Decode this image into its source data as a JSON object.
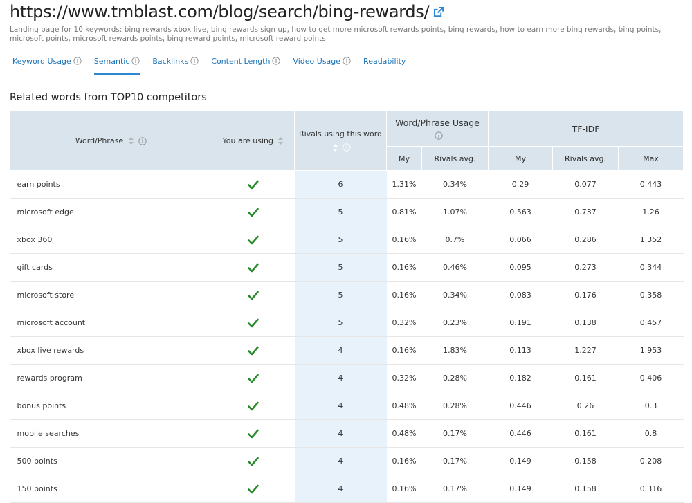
{
  "page": {
    "url": "https://www.tmblast.com/blog/search/bing-rewards/",
    "description": "Landing page for 10 keywords: bing rewards xbox live, bing rewards sign up, how to get more microsoft rewards points, bing rewards, how to earn more bing rewards, bing points, microsoft points, microsoft rewards points, bing reward points, microsoft reward points"
  },
  "tabs": [
    {
      "label": "Keyword Usage",
      "info": true
    },
    {
      "label": "Semantic",
      "info": true,
      "active": true
    },
    {
      "label": "Backlinks",
      "info": true
    },
    {
      "label": "Content Length",
      "info": true
    },
    {
      "label": "Video Usage",
      "info": true
    },
    {
      "label": "Readability",
      "info": false
    }
  ],
  "section_title": "Related words from TOP10 competitors",
  "table": {
    "headers": {
      "word": "Word/Phrase",
      "using": "You are using",
      "rivals": "Rivals using this word",
      "usage_group": "Word/Phrase Usage",
      "tfidf_group": "TF-IDF",
      "my": "My",
      "rivals_avg": "Rivals avg.",
      "max": "Max"
    },
    "rows": [
      {
        "word": "earn points",
        "rivals": "6",
        "usage_my": "1.31%",
        "usage_avg": "0.34%",
        "tf_my": "0.29",
        "tf_avg": "0.077",
        "tf_max": "0.443"
      },
      {
        "word": "microsoft edge",
        "rivals": "5",
        "usage_my": "0.81%",
        "usage_avg": "1.07%",
        "tf_my": "0.563",
        "tf_avg": "0.737",
        "tf_max": "1.26"
      },
      {
        "word": "xbox 360",
        "rivals": "5",
        "usage_my": "0.16%",
        "usage_avg": "0.7%",
        "tf_my": "0.066",
        "tf_avg": "0.286",
        "tf_max": "1.352"
      },
      {
        "word": "gift cards",
        "rivals": "5",
        "usage_my": "0.16%",
        "usage_avg": "0.46%",
        "tf_my": "0.095",
        "tf_avg": "0.273",
        "tf_max": "0.344"
      },
      {
        "word": "microsoft store",
        "rivals": "5",
        "usage_my": "0.16%",
        "usage_avg": "0.34%",
        "tf_my": "0.083",
        "tf_avg": "0.176",
        "tf_max": "0.358"
      },
      {
        "word": "microsoft account",
        "rivals": "5",
        "usage_my": "0.32%",
        "usage_avg": "0.23%",
        "tf_my": "0.191",
        "tf_avg": "0.138",
        "tf_max": "0.457"
      },
      {
        "word": "xbox live rewards",
        "rivals": "4",
        "usage_my": "0.16%",
        "usage_avg": "1.83%",
        "tf_my": "0.113",
        "tf_avg": "1.227",
        "tf_max": "1.953"
      },
      {
        "word": "rewards program",
        "rivals": "4",
        "usage_my": "0.32%",
        "usage_avg": "0.28%",
        "tf_my": "0.182",
        "tf_avg": "0.161",
        "tf_max": "0.406"
      },
      {
        "word": "bonus points",
        "rivals": "4",
        "usage_my": "0.48%",
        "usage_avg": "0.28%",
        "tf_my": "0.446",
        "tf_avg": "0.26",
        "tf_max": "0.3"
      },
      {
        "word": "mobile searches",
        "rivals": "4",
        "usage_my": "0.48%",
        "usage_avg": "0.17%",
        "tf_my": "0.446",
        "tf_avg": "0.161",
        "tf_max": "0.8"
      },
      {
        "word": "500 points",
        "rivals": "4",
        "usage_my": "0.16%",
        "usage_avg": "0.17%",
        "tf_my": "0.149",
        "tf_avg": "0.158",
        "tf_max": "0.208"
      },
      {
        "word": "150 points",
        "rivals": "4",
        "usage_my": "0.16%",
        "usage_avg": "0.17%",
        "tf_my": "0.149",
        "tf_avg": "0.158",
        "tf_max": "0.316"
      }
    ]
  },
  "icons": {
    "external": "external-link-icon",
    "info": "info-icon",
    "sort": "sort-icon",
    "check": "checkmark-icon"
  },
  "colors": {
    "accent": "#2f86d1",
    "link": "#1a73b8",
    "check": "#2a8a2a",
    "rivals_col_bg": "#e7f2fb"
  }
}
